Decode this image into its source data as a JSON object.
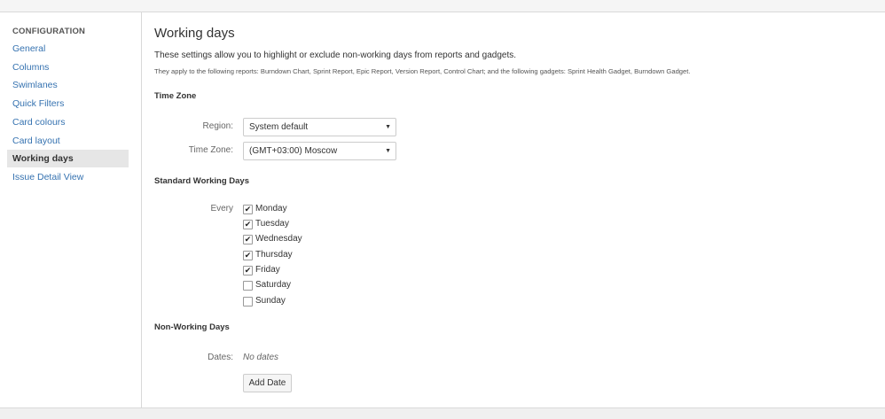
{
  "sidebar": {
    "heading": "CONFIGURATION",
    "items": [
      {
        "label": "General"
      },
      {
        "label": "Columns"
      },
      {
        "label": "Swimlanes"
      },
      {
        "label": "Quick Filters"
      },
      {
        "label": "Card colours"
      },
      {
        "label": "Card layout"
      },
      {
        "label": "Working days",
        "active": true
      },
      {
        "label": "Issue Detail View"
      }
    ]
  },
  "main": {
    "title": "Working days",
    "description": "These settings allow you to highlight or exclude non-working days from reports and gadgets.",
    "subdescription": "They apply to the following reports: Burndown Chart, Sprint Report, Epic Report, Version Report, Control Chart; and the following gadgets: Sprint Health Gadget, Burndown Gadget.",
    "time_zone": {
      "section_title": "Time Zone",
      "region_label": "Region:",
      "region_value": "System default",
      "timezone_label": "Time Zone:",
      "timezone_value": "(GMT+03:00) Moscow"
    },
    "standard_working_days": {
      "section_title": "Standard Working Days",
      "every_label": "Every",
      "days": [
        {
          "label": "Monday",
          "checked": true
        },
        {
          "label": "Tuesday",
          "checked": true
        },
        {
          "label": "Wednesday",
          "checked": true
        },
        {
          "label": "Thursday",
          "checked": true
        },
        {
          "label": "Friday",
          "checked": true
        },
        {
          "label": "Saturday",
          "checked": false
        },
        {
          "label": "Sunday",
          "checked": false
        }
      ]
    },
    "non_working_days": {
      "section_title": "Non-Working Days",
      "dates_label": "Dates:",
      "dates_value": "No dates",
      "add_button": "Add Date"
    }
  },
  "colors": {
    "link": "#3572b0",
    "active_nav_bg": "#e6e6e6",
    "border": "#d9d9d9"
  }
}
